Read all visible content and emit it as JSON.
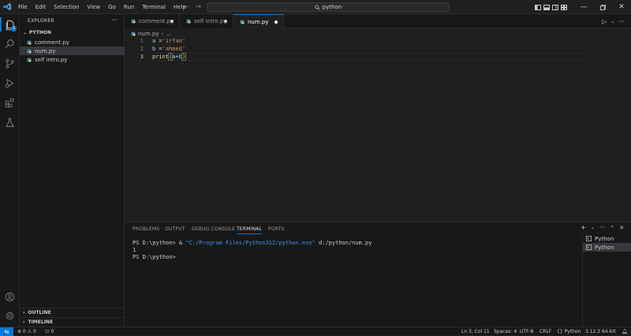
{
  "menu": [
    "File",
    "Edit",
    "Selection",
    "View",
    "Go",
    "Run",
    "Terminal",
    "Help"
  ],
  "search": {
    "text": "python"
  },
  "sidebar": {
    "title": "EXPLORER",
    "folder": "PYTHON",
    "files": [
      "comment.py",
      "num.py",
      "self intro.py"
    ],
    "outline": "OUTLINE",
    "timeline": "TIMELINE"
  },
  "tabs": [
    {
      "label": "comment.py"
    },
    {
      "label": "self intro.py"
    },
    {
      "label": "num.py"
    }
  ],
  "editor": {
    "breadcrumb_file": "num.py",
    "breadcrumb_sep": "›",
    "breadcrumb_more": "...",
    "line_numbers": [
      "1",
      "2",
      "3"
    ],
    "lines": {
      "l1_var": "a",
      "l1_op": " =",
      "l1_str": "'irfan'",
      "l2_var": "b",
      "l2_op": " =",
      "l2_str": "'ahmed'",
      "l3_fn": "print",
      "l3_open": "(",
      "l3_args": "a+b",
      "l3_close": ")"
    }
  },
  "panel": {
    "tabs": [
      "PROBLEMS",
      "OUTPUT",
      "DEBUG CONSOLE",
      "TERMINAL",
      "PORTS"
    ],
    "active_tab": "TERMINAL",
    "terminal": {
      "line1_prompt": "PS D:\\python> & ",
      "line1_exe": "\"C:/Program Files/Python312/python.exe\"",
      "line1_arg": " d:/python/num.py",
      "line2": "1",
      "line3": "PS D:\\python>"
    },
    "terminal_list": [
      "Python",
      "Python"
    ]
  },
  "status": {
    "errors": "0",
    "warnings": "0",
    "ports": "0",
    "position": "Ln 3, Col 11",
    "spaces": "Spaces: 4",
    "encoding": "UTF-8",
    "eol": "CRLF",
    "language": "Python",
    "interpreter": "3.12.3 64-bit"
  },
  "colors": {
    "accent": "#0078d4",
    "badge": "#0078d4",
    "python_icon": "#4b8bbe"
  },
  "badges": {
    "explorer": "3"
  }
}
